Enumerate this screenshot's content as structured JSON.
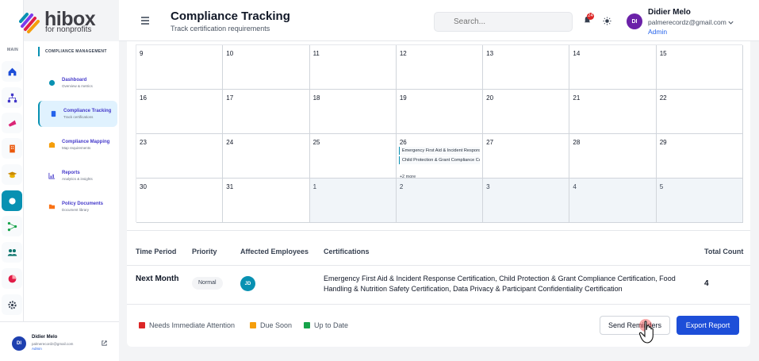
{
  "brand": {
    "name": "hibox",
    "tagline": "for nonprofits"
  },
  "rail": {
    "section_label": "MAIN"
  },
  "nav": {
    "section": "COMPLIANCE MANAGEMENT",
    "items": [
      {
        "title": "Dashboard",
        "sub": "Overview & metrics",
        "icon": "dashboard-icon"
      },
      {
        "title": "Compliance Tracking",
        "sub": "Track certifications",
        "icon": "clipboard-icon"
      },
      {
        "title": "Compliance Mapping",
        "sub": "Map requirements",
        "icon": "map-icon"
      },
      {
        "title": "Reports",
        "sub": "Analytics & insights",
        "icon": "chart-icon"
      },
      {
        "title": "Policy Documents",
        "sub": "Document library",
        "icon": "folder-icon"
      }
    ],
    "user": {
      "initials": "DI",
      "name": "Didier Melo",
      "email": "palmerecordz@gmail.com",
      "role": "Admin"
    }
  },
  "header": {
    "title": "Compliance Tracking",
    "subtitle": "Track certification requirements",
    "search_placeholder": "Search...",
    "notif_count": "24",
    "user": {
      "initials": "DI",
      "name": "Didier Melo",
      "email": "palmerecordz@gmail.com",
      "role": "Admin"
    }
  },
  "calendar": {
    "rows": [
      [
        {
          "d": "9"
        },
        {
          "d": "10"
        },
        {
          "d": "11"
        },
        {
          "d": "12"
        },
        {
          "d": "13"
        },
        {
          "d": "14"
        },
        {
          "d": "15"
        }
      ],
      [
        {
          "d": "16"
        },
        {
          "d": "17"
        },
        {
          "d": "18"
        },
        {
          "d": "19"
        },
        {
          "d": "20"
        },
        {
          "d": "21"
        },
        {
          "d": "22"
        }
      ],
      [
        {
          "d": "23"
        },
        {
          "d": "24"
        },
        {
          "d": "25"
        },
        {
          "d": "26",
          "events": [
            "Emergency First Aid & Incident Response Certification",
            "Child Protection & Grant Compliance Certification"
          ],
          "more": "+2 more"
        },
        {
          "d": "27"
        },
        {
          "d": "28"
        },
        {
          "d": "29"
        }
      ],
      [
        {
          "d": "30"
        },
        {
          "d": "31"
        },
        {
          "d": "1",
          "other": true
        },
        {
          "d": "2",
          "other": true
        },
        {
          "d": "3",
          "other": true
        },
        {
          "d": "4",
          "other": true
        },
        {
          "d": "5",
          "other": true
        }
      ]
    ]
  },
  "table": {
    "headers": {
      "period": "Time Period",
      "priority": "Priority",
      "employees": "Affected Employees",
      "certifications": "Certifications",
      "total": "Total Count"
    },
    "row": {
      "period": "Next Month",
      "priority": "Normal",
      "employee_initials": "JD",
      "certifications": "Emergency First Aid & Incident Response Certification, Child Protection & Grant Compliance Certification, Food Handling & Nutrition Safety Certification, Data Privacy & Participant Confidentiality Certification",
      "total": "4"
    }
  },
  "legend": [
    {
      "label": "Needs Immediate Attention",
      "color": "#dc2626"
    },
    {
      "label": "Due Soon",
      "color": "#f59e0b"
    },
    {
      "label": "Up to Date",
      "color": "#16a34a"
    }
  ],
  "actions": {
    "send_reminders": "Send Reminders",
    "export_report": "Export Report"
  },
  "colors": {
    "accent": "#0891b2",
    "primary": "#1d4ed8"
  }
}
